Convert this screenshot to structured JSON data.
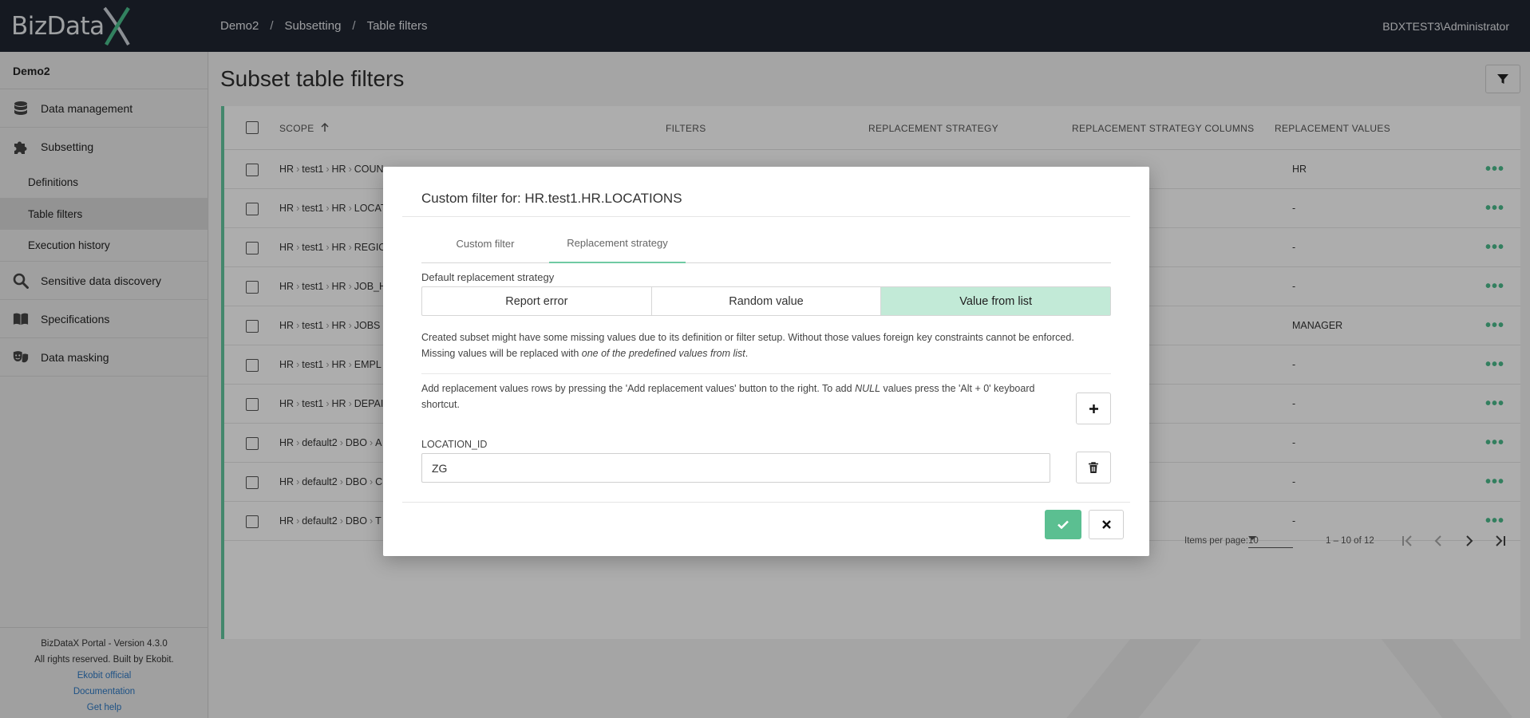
{
  "app": {
    "logo_text": "BizData",
    "logo_mark": "X"
  },
  "breadcrumb": [
    "Demo2",
    "Subsetting",
    "Table filters"
  ],
  "breadcrumb_sep": "/",
  "user": "BDXTEST3\\Administrator",
  "sidebar": {
    "project": "Demo2",
    "items": [
      {
        "label": "Data management",
        "icon": "database-icon"
      },
      {
        "label": "Subsetting",
        "icon": "puzzle-icon"
      },
      {
        "label": "Sensitive data discovery",
        "icon": "search-icon"
      },
      {
        "label": "Specifications",
        "icon": "book-icon"
      },
      {
        "label": "Data masking",
        "icon": "masks-icon"
      }
    ],
    "subitems": [
      {
        "label": "Definitions"
      },
      {
        "label": "Table filters",
        "active": true
      },
      {
        "label": "Execution history"
      }
    ],
    "footer": {
      "version": "BizDataX Portal - Version 4.3.0",
      "rights": "All rights reserved. Built by Ekobit.",
      "links": [
        "Ekobit official",
        "Documentation",
        "Get help"
      ]
    }
  },
  "page": {
    "title": "Subset table filters"
  },
  "table": {
    "headers": {
      "scope": "SCOPE",
      "filters": "FILTERS",
      "strategy": "REPLACEMENT STRATEGY",
      "strategy_cols": "REPLACEMENT STRATEGY COLUMNS",
      "values": "REPLACEMENT VALUES"
    },
    "rows": [
      {
        "scope": [
          "HR",
          "test1",
          "HR",
          "COUN"
        ],
        "value": "HR"
      },
      {
        "scope": [
          "HR",
          "test1",
          "HR",
          "LOCAT"
        ],
        "value": "-"
      },
      {
        "scope": [
          "HR",
          "test1",
          "HR",
          "REGIC"
        ],
        "value": "-"
      },
      {
        "scope": [
          "HR",
          "test1",
          "HR",
          "JOB_H"
        ],
        "value": "-"
      },
      {
        "scope": [
          "HR",
          "test1",
          "HR",
          "JOBS"
        ],
        "value": "MANAGER"
      },
      {
        "scope": [
          "HR",
          "test1",
          "HR",
          "EMPL"
        ],
        "value": "-"
      },
      {
        "scope": [
          "HR",
          "test1",
          "HR",
          "DEPAI"
        ],
        "value": "-"
      },
      {
        "scope": [
          "HR",
          "default2",
          "DBO",
          "A"
        ],
        "value": "-"
      },
      {
        "scope": [
          "HR",
          "default2",
          "DBO",
          "C"
        ],
        "value": "-"
      },
      {
        "scope": [
          "HR",
          "default2",
          "DBO",
          "T"
        ],
        "value": "-"
      }
    ],
    "pager": {
      "items_per_page_label": "Items per page:",
      "items_per_page": "10",
      "range": "1 – 10 of 12"
    }
  },
  "modal": {
    "title": "Custom filter for: HR.test1.HR.LOCATIONS",
    "tabs": [
      "Custom filter",
      "Replacement strategy"
    ],
    "active_tab": "Replacement strategy",
    "default_strategy_label": "Default replacement strategy",
    "strategy_options": [
      "Report error",
      "Random value",
      "Value from list"
    ],
    "selected_strategy": "Value from list",
    "description_1": "Created subset might have some missing values due to its definition or filter setup. Without those values foreign key constraints cannot be enforced.",
    "description_2_prefix": "Missing values will be replaced with ",
    "description_2_em": "one of the predefined values from list",
    "description_2_suffix": ".",
    "help_1": "Add replacement values rows by pressing the 'Add replacement values' button to the right. To add ",
    "help_em": "NULL",
    "help_2": " values press the 'Alt + 0' keyboard shortcut.",
    "column_label": "LOCATION_ID",
    "column_value": "ZG"
  },
  "colors": {
    "accent": "#5bbf91",
    "selected_option": "#c2ead7",
    "topbar": "#1f2531"
  }
}
